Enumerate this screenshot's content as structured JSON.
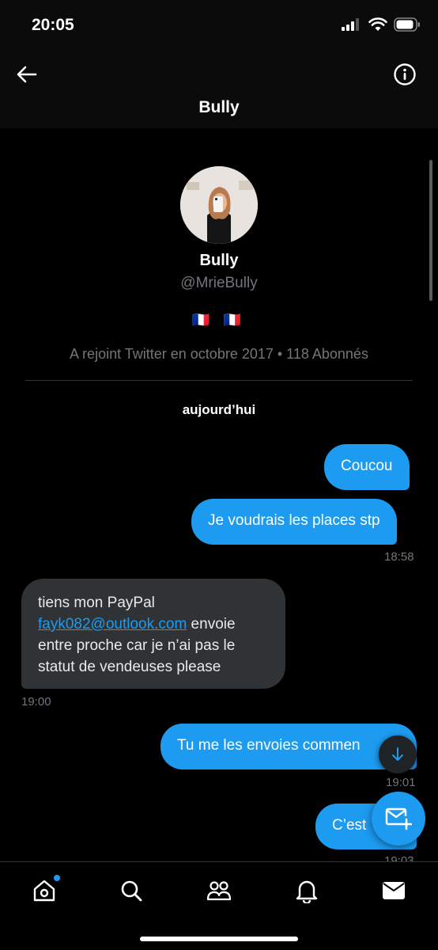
{
  "status_bar": {
    "time": "20:05"
  },
  "header": {
    "title": "Bully"
  },
  "profile": {
    "name": "Bully",
    "handle": "@MrieBully",
    "flags": "🇫🇷 🇫🇷",
    "meta": "A rejoint Twitter en octobre 2017 • 118 Abonnés"
  },
  "conversation": {
    "day_label": "aujourd’hui",
    "messages": [
      {
        "from": "me",
        "text": "Coucou"
      },
      {
        "from": "me",
        "text": "Je voudrais les places stp",
        "time": "18:58"
      },
      {
        "from": "them",
        "text_before": "tiens mon PayPal",
        "link": "fayk082@outlook.com",
        "text_after_link": " envoie",
        "line3": "entre proche car je n’ai pas le",
        "line4": "statut de vendeuses please",
        "time": "19:00"
      },
      {
        "from": "me",
        "text": "Tu me les envoies commen",
        "time": "19:01"
      },
      {
        "from": "me",
        "text": "C’est",
        "time": "19:03"
      }
    ]
  },
  "icons": {
    "back": "arrow-left-icon",
    "info": "info-icon",
    "scroll_down": "arrow-down-icon",
    "compose": "new-message-icon",
    "tabs": [
      "home-icon",
      "search-icon",
      "communities-icon",
      "bell-icon",
      "mail-icon"
    ]
  },
  "colors": {
    "accent": "#1d9bf0",
    "received_bubble": "#2f3336",
    "muted_text": "#71767b",
    "background": "#000000"
  }
}
